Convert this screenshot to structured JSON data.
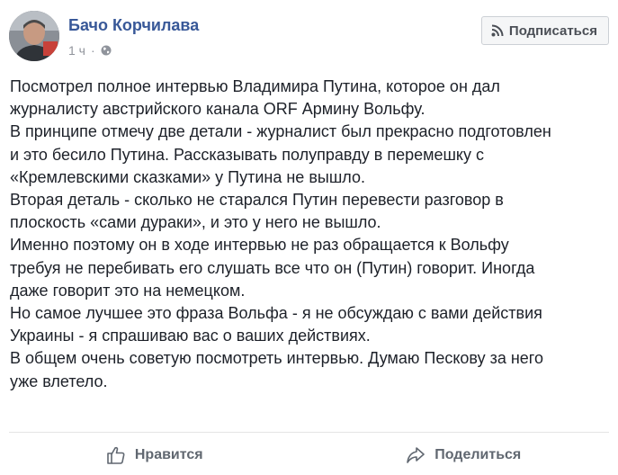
{
  "post": {
    "author": "Бачо Корчилава",
    "time": "1 ч",
    "privacy_icon": "globe-icon",
    "subscribe_label": "Подписаться",
    "lines": [
      "Посмотрел полное интервью Владимира Путина, которое он дал",
      "журналисту австрийского канала ORF Армину Вольфу.",
      "В принципе отмечу две детали - журналист был прекрасно подготовлен",
      "и это бесило Путина. Рассказывать полуправду в перемешку с",
      "«Кремлевскими сказками» у Путина не вышло.",
      "Вторая деталь - сколько не старался Путин перевести разговор в",
      "плоскость «сами дураки», и это у него не вышло.",
      "Именно поэтому он в ходе интервью не раз обращается к Вольфу",
      "требуя не перебивать его слушать все что он (Путин) говорит. Иногда",
      "даже говорит это на немецком.",
      "Но самое лучшее это фраза Вольфа - я не обсуждаю с вами действия",
      "Украины - я спрашиваю вас о ваших действиях.",
      "В общем очень советую посмотреть интервью. Думаю Пескову за него",
      "уже влетело."
    ]
  },
  "actions": {
    "like_label": "Нравится",
    "share_label": "Поделиться"
  },
  "colors": {
    "author_link": "#385898",
    "meta_text": "#90949c",
    "action_text": "#606770"
  }
}
